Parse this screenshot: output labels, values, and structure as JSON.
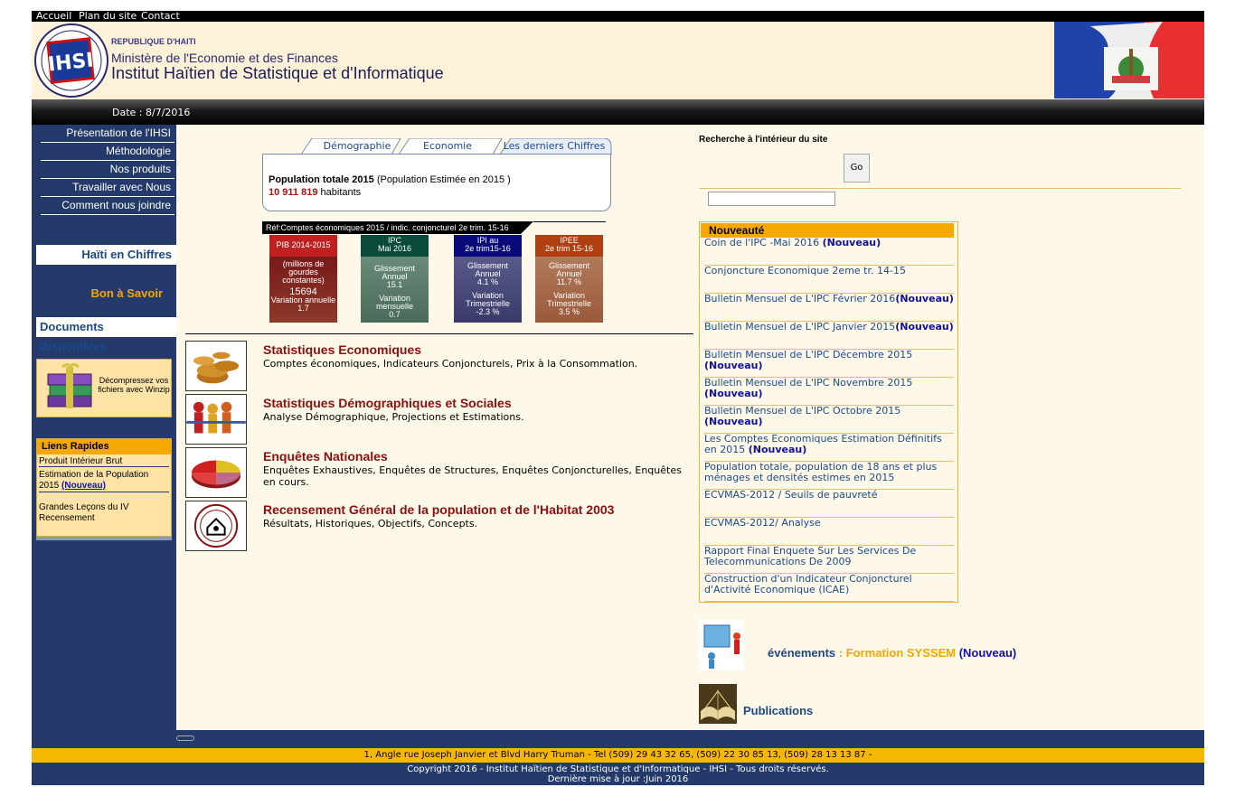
{
  "topnav": {
    "home": "Accueil",
    "sitemap": "Plan du site",
    "contact": "Contact"
  },
  "header": {
    "republic": "REPUBLIQUE D'HAITI",
    "ministry": "Ministère de l'Economie et des Finances",
    "institute": "Institut Haïtien de Statistique et d'Informatique",
    "logo_text": "IHSI"
  },
  "datebar": {
    "date": "Date : 8/7/2016"
  },
  "menu": {
    "items": [
      {
        "label": "Présentation de l'IHSI"
      },
      {
        "label": "Méthodologie"
      },
      {
        "label": "Nos produits"
      },
      {
        "label": "Travailler avec Nous"
      },
      {
        "label": "Comment nous joindre"
      }
    ],
    "haiti_chiffres": "Haïti en Chiffres",
    "bon_savoir": "Bon à Savoir",
    "documents": "Documents Disponibles",
    "winzip": "Décompressez vos fichiers avec Winzip"
  },
  "liens": {
    "title": "Liens Rapides",
    "pib": "Produit Intérieur Brut",
    "estimation": "Estimation de la Population 2015",
    "estimation_new": "(Nouveau)",
    "lecons": "Grandes Leçons du IV Recensement"
  },
  "tabs": {
    "demographie": "Démographie",
    "economie": "Economie",
    "derniers": "Les derniers Chiffres",
    "pop_title": "Population totale 2015",
    "pop_sub": "(Population Estimée en 2015 )",
    "pop_value": "10 911 819",
    "pop_unit": "habitants"
  },
  "indicators": {
    "ref": "Réf:Comptes économiques 2015 / indic. conjoncturel 2e trim. 15-16",
    "pib": {
      "h1": "PIB 2014-2015",
      "l1": "(millions de gourdes constantes)",
      "v1": "15694",
      "l2": "Variation annuelle",
      "v2": "1.7"
    },
    "ipc": {
      "h1": "IPC",
      "h2": "Mai 2016",
      "l1": "Glissement Annuel",
      "v1": "15.1",
      "l2": "Variation mensuelle",
      "v2": "0.7"
    },
    "ipi": {
      "h1": "IPI au",
      "h2": "2e trim15-16",
      "l1": "Glissement Annuel",
      "v1": "4.1 %",
      "l2": "Variation Trimestrielle",
      "v2": "-2.3 %"
    },
    "ipee": {
      "h1": "IPEE",
      "h2": "2e trim 15-16",
      "l1": "Glissement Annuel",
      "v1": "11.7 %",
      "l2": "Variation Trimestrielle",
      "v2": "3.5 %"
    }
  },
  "stats": [
    {
      "title": "Statistiques Economiques",
      "desc": "Comptes économiques, Indicateurs Conjoncturels, Prix à la Consommation."
    },
    {
      "title": "Statistiques Démographiques et Sociales",
      "desc": "Analyse Démographique, Projections et Estimations."
    },
    {
      "title": "Enquêtes Nationales",
      "desc": "Enquêtes Exhaustives, Enquêtes de Structures, Enquêtes Conjoncturelles, Enquêtes en cours."
    },
    {
      "title": "Recensement Général de la population et de l'Habitat 2003",
      "desc": "Résultats, Historiques, Objectifs, Concepts."
    }
  ],
  "search": {
    "label": "Recherche à l'intérieur du site",
    "go": "Go",
    "value": ""
  },
  "nouveaute": {
    "title": "Nouveauté",
    "new": "(Nouveau)",
    "items": [
      {
        "text": "Coin de l'IPC -Mai 2016 ",
        "new": true
      },
      {
        "text": "Conjoncture Economique 2eme tr. 14-15",
        "new": false
      },
      {
        "text": "Bulletin Mensuel de L'IPC Février 2016",
        "new": true
      },
      {
        "text": "Bulletin Mensuel de L'IPC Janvier 2015",
        "new": true
      },
      {
        "text": "Bulletin Mensuel de L'IPC Décembre 2015 ",
        "new": true
      },
      {
        "text": "Bulletin Mensuel de L'IPC Novembre 2015 ",
        "new": true
      },
      {
        "text": "Bulletin Mensuel de L'IPC Octobre 2015 ",
        "new": true
      },
      {
        "text": "Les Comptes Economiques Estimation Définitifs en 2015 ",
        "new": true
      },
      {
        "text": "Population totale, population de 18 ans et plus ménages et densités estimes en 2015",
        "new": false
      },
      {
        "text": "ECVMAS-2012 / Seuils de pauvreté",
        "new": false
      },
      {
        "text": "ECVMAS-2012/ Analyse",
        "new": false
      },
      {
        "text": "Rapport Final Enquete Sur Les Services De Telecommunications De 2009",
        "new": false
      },
      {
        "text": "Construction d'un Indicateur Conjoncturel d'Activité Economique (ICAE)",
        "new": false
      }
    ]
  },
  "events": {
    "label": "événements",
    "sep": " : ",
    "name": "Formation SYSSEM",
    "new": "(Nouveau)"
  },
  "publications": {
    "label": "Publications"
  },
  "footer": {
    "address": "1, Angle rue Joseph Janvier et Blvd Harry Truman   -   Tel (509) 29 43 32 65, (509) 22 30 85 13, (509) 28 13 13 87  -",
    "copyright": "Copyright 2016 - Institut Haïtien de Statistique et d'Informatique - IHSI - Tous droits réservés.",
    "updated": "Dernière mise à jour :Juin 2016"
  },
  "colors": {
    "navy": "#233a6b",
    "cream": "#fef8e8",
    "gold": "#f5b800",
    "maroon": "#8b1010"
  }
}
